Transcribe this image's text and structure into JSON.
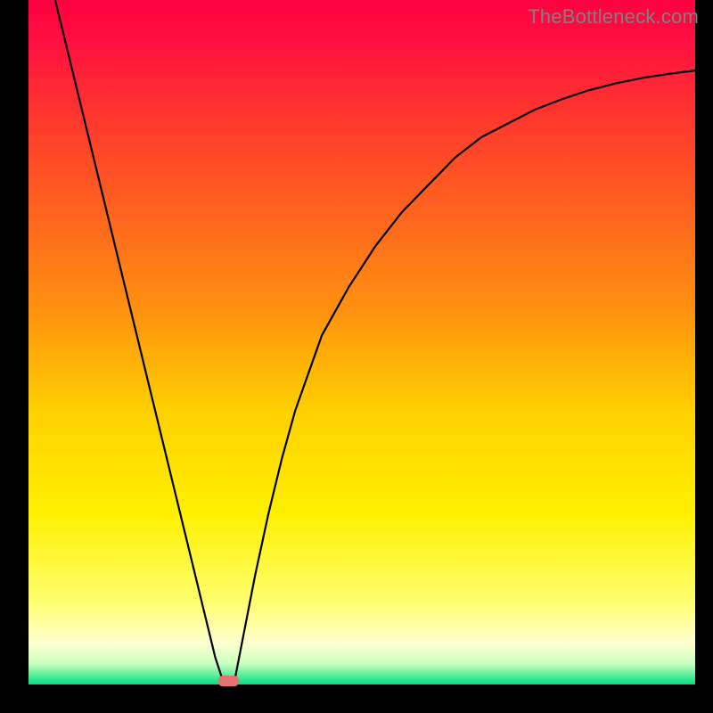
{
  "watermark": "TheBottleneck.com",
  "chart_data": {
    "type": "line",
    "title": "",
    "xlabel": "",
    "ylabel": "",
    "xlim": [
      0,
      100
    ],
    "ylim": [
      0,
      100
    ],
    "grid": false,
    "legend": false,
    "background_gradient": [
      {
        "pos": 0.0,
        "color": "#ff0040"
      },
      {
        "pos": 0.06,
        "color": "#ff1040"
      },
      {
        "pos": 0.15,
        "color": "#ff3030"
      },
      {
        "pos": 0.3,
        "color": "#ff6020"
      },
      {
        "pos": 0.45,
        "color": "#ff9010"
      },
      {
        "pos": 0.6,
        "color": "#ffd000"
      },
      {
        "pos": 0.75,
        "color": "#fff000"
      },
      {
        "pos": 0.88,
        "color": "#ffff70"
      },
      {
        "pos": 0.94,
        "color": "#ffffd0"
      },
      {
        "pos": 0.97,
        "color": "#c8ffc0"
      },
      {
        "pos": 1.0,
        "color": "#00e080"
      }
    ],
    "series": [
      {
        "name": "bottleneck-curve",
        "color": "#000000",
        "x": [
          4,
          6,
          8,
          10,
          12,
          14,
          16,
          18,
          20,
          22,
          24,
          26,
          28,
          29,
          30,
          31,
          32,
          34,
          36,
          38,
          40,
          44,
          48,
          52,
          56,
          60,
          64,
          68,
          72,
          76,
          80,
          84,
          88,
          92,
          96,
          100
        ],
        "values": [
          100,
          92,
          84,
          76,
          68,
          60,
          52,
          44,
          36,
          28,
          20,
          12,
          4,
          1,
          0,
          1,
          6,
          16,
          25,
          33,
          40,
          51,
          58,
          64,
          69,
          73,
          77,
          80,
          82,
          84,
          85.5,
          86.8,
          87.8,
          88.6,
          89.2,
          89.7
        ]
      }
    ],
    "marker": {
      "name": "optimal-point",
      "x": 30,
      "y": 0.5,
      "color": "#e57373",
      "width": 3.2,
      "height": 1.6,
      "rx": 0.8
    }
  }
}
